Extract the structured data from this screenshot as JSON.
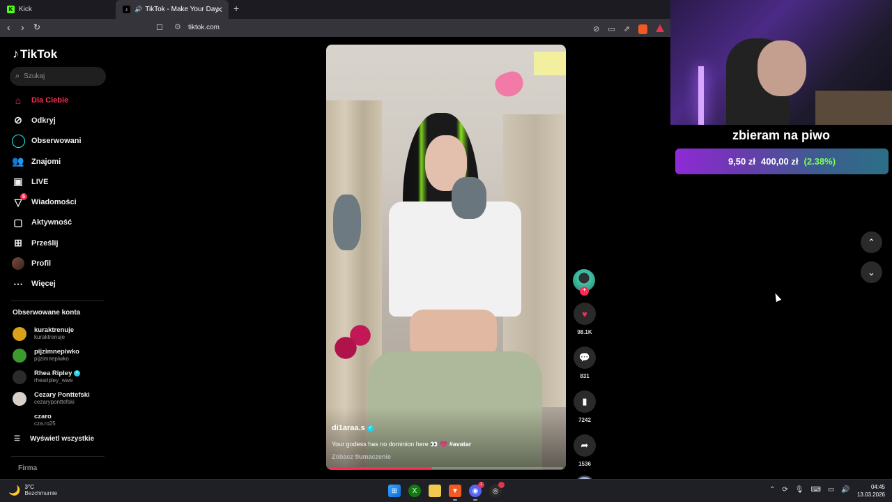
{
  "browser": {
    "tabs": [
      {
        "title": "Kick",
        "active": false
      },
      {
        "title": "TikTok - Make Your Day",
        "active": true
      }
    ],
    "url": "tiktok.com"
  },
  "tiktok": {
    "logo": "TikTok",
    "search_placeholder": "Szukaj",
    "nav": [
      {
        "label": "Dla Ciebie",
        "icon": "home-icon",
        "active": true
      },
      {
        "label": "Odkryj",
        "icon": "compass-icon"
      },
      {
        "label": "Obserwowani",
        "icon": "following-icon"
      },
      {
        "label": "Znajomi",
        "icon": "friends-icon"
      },
      {
        "label": "LIVE",
        "icon": "live-icon"
      },
      {
        "label": "Wiadomości",
        "icon": "messages-icon",
        "badge": "5"
      },
      {
        "label": "Aktywność",
        "icon": "activity-icon"
      },
      {
        "label": "Prześlij",
        "icon": "upload-icon"
      },
      {
        "label": "Profil",
        "icon": "profile-avatar"
      },
      {
        "label": "Więcej",
        "icon": "more-icon"
      }
    ],
    "following_title": "Obserwowane konta",
    "following": [
      {
        "name": "kuraktrenuje",
        "handle": "kuraktrenuje",
        "color": "#d9a21a"
      },
      {
        "name": "pijzimnepiwko",
        "handle": "pijzimnepiwko",
        "color": "#3c9a2e"
      },
      {
        "name": "Rhea Ripley",
        "handle": "rhearipley_wwe",
        "verified": true,
        "color": "#2b2b2b"
      },
      {
        "name": "Cezary Ponttefski",
        "handle": "cezaryponttefski",
        "color": "#d8d0c8"
      },
      {
        "name": "czaro",
        "handle": "cza.ro25",
        "color": "#000000"
      }
    ],
    "show_all": "Wyświetl wszystkie",
    "footer": "Firma",
    "video": {
      "author": "di1araa.s",
      "description_pre": "Your godess has no dominion here 👀 ",
      "description_heart": "💗",
      "description_tag": " #avatar",
      "translate": "Zobacz tłumaczenie",
      "progress": 0.44
    },
    "actions": {
      "likes": "98.1K",
      "comments": "831",
      "saves": "7242",
      "shares": "1536"
    }
  },
  "overlay": {
    "goal_title": "zbieram na piwo",
    "goal_current": "9,50 zł",
    "goal_target": "400,00 zł",
    "goal_percent": "(2.38%)"
  },
  "taskbar": {
    "temp": "3°C",
    "weather": "Bezchmurnie",
    "time": "04:45",
    "date": "13.03.2026",
    "discord_badge": "1"
  },
  "colors": {
    "accent": "#fe2c55",
    "goal_percent": "#7dff5a"
  }
}
